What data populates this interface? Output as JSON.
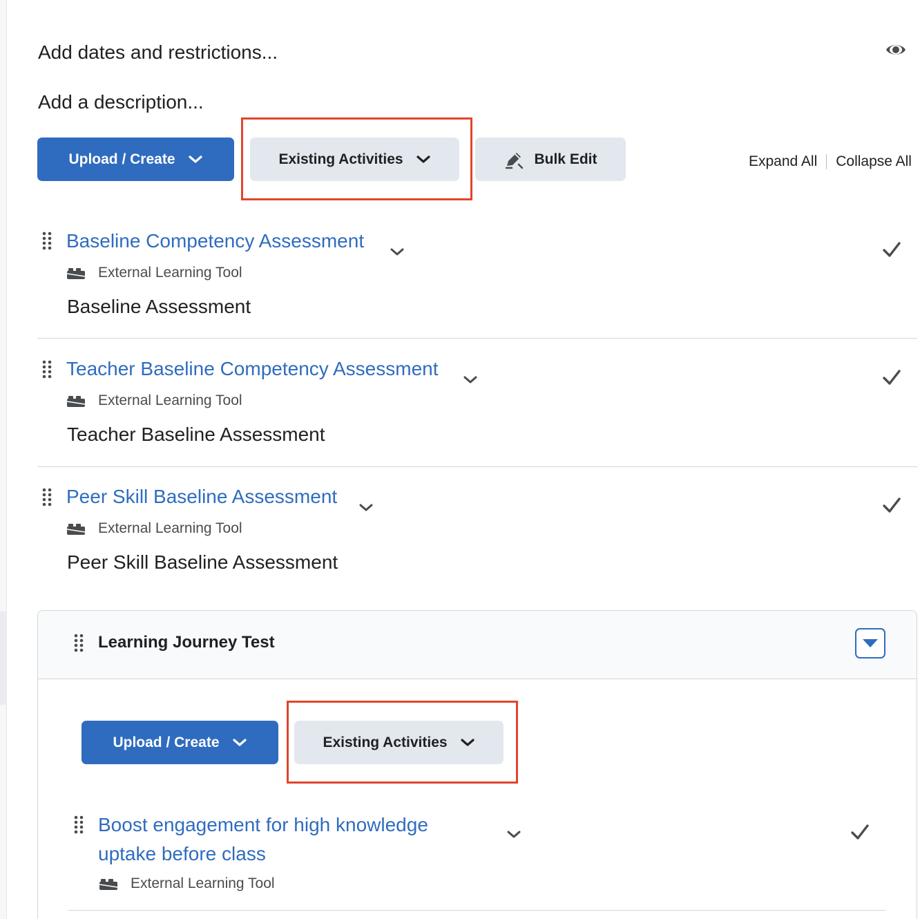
{
  "header": {
    "dates_link": "Add dates and restrictions...",
    "description_link": "Add a description...",
    "visibility_icon": "eye-icon"
  },
  "toolbar": {
    "upload_create_label": "Upload / Create",
    "existing_activities_label": "Existing Activities",
    "bulk_edit_label": "Bulk Edit",
    "expand_all_label": "Expand All",
    "collapse_all_label": "Collapse All"
  },
  "items": [
    {
      "title": "Baseline Competency Assessment",
      "type_label": "External Learning Tool",
      "description": "Baseline Assessment"
    },
    {
      "title": "Teacher Baseline Competency Assessment",
      "type_label": "External Learning Tool",
      "description": "Teacher Baseline Assessment"
    },
    {
      "title": "Peer Skill Baseline Assessment",
      "type_label": "External Learning Tool",
      "description": "Peer Skill Baseline Assessment"
    }
  ],
  "module": {
    "title": "Learning Journey Test",
    "toolbar": {
      "upload_create_label": "Upload / Create",
      "existing_activities_label": "Existing Activities"
    },
    "items": [
      {
        "title": "Boost engagement for high knowledge uptake before class",
        "type_label": "External Learning Tool"
      }
    ]
  },
  "colors": {
    "primary": "#2f6cbf",
    "secondary_button": "#e3e8ef",
    "highlight": "#e0452d",
    "text": "#202122"
  }
}
